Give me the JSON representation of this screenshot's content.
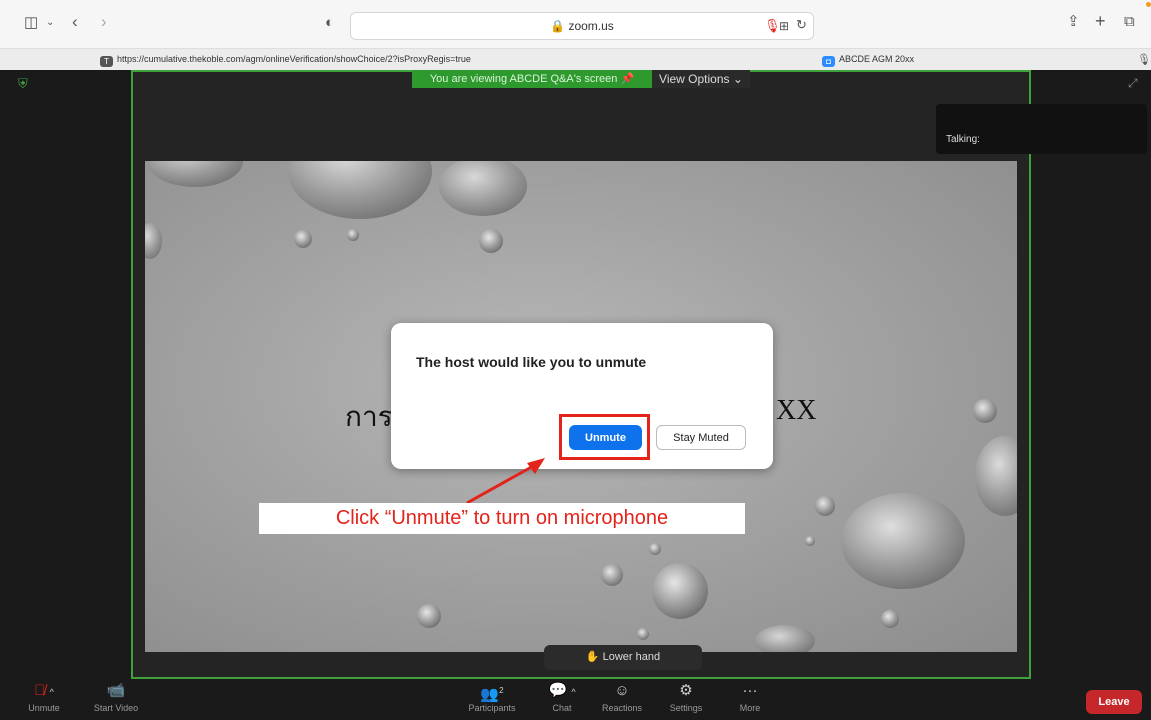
{
  "browser": {
    "address": "zoom.us",
    "tabs": [
      {
        "label": "https://cumulative.thekoble.com/agm/onlineVerification/showChoice/2?isProxyRegis=true",
        "icon": "T"
      },
      {
        "label": "ABCDE AGM 20xx",
        "icon": "zoom-icon"
      }
    ]
  },
  "share": {
    "viewing_text": "You are viewing ABCDE Q&A's screen",
    "view_options": "View Options",
    "talking_label": "Talking:",
    "slide_text_left": "การ",
    "slide_text_right": "XX"
  },
  "dialog": {
    "title": "The host would like you to unmute",
    "primary": "Unmute",
    "secondary": "Stay Muted"
  },
  "caption": "Click “Unmute” to turn on microphone",
  "lower_hand": "Lower hand",
  "toolbar": {
    "unmute": "Unmute",
    "start_video": "Start Video",
    "participants": "Participants",
    "participants_count": "2",
    "chat": "Chat",
    "reactions": "Reactions",
    "settings": "Settings",
    "more": "More",
    "leave": "Leave"
  },
  "colors": {
    "accent": "#0e72ed",
    "share_border": "#3fa33c",
    "annotation": "#e4231b",
    "leave": "#c5272b"
  }
}
